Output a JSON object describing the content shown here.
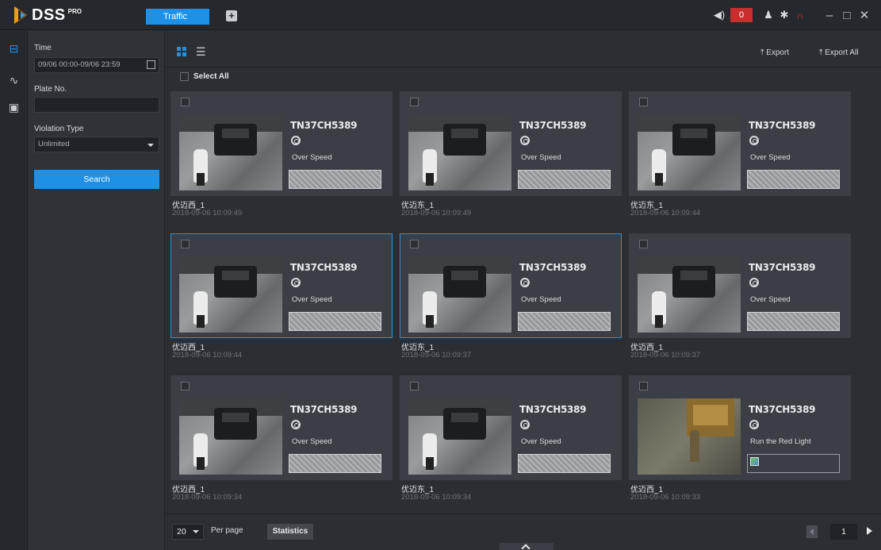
{
  "app": {
    "logo_text": "DSS",
    "logo_sup": "PRO",
    "active_tab": "Traffic",
    "alarm_count": "0"
  },
  "filter": {
    "time_label": "Time",
    "time_value": "09/06 00:00-09/06 23:59",
    "plate_label": "Plate No.",
    "plate_value": "",
    "violation_label": "Violation Type",
    "violation_value": "Unlimited",
    "search_label": "Search"
  },
  "toolbar": {
    "export_label": "Export",
    "export_all_label": "Export All",
    "select_all_label": "Select All"
  },
  "records": [
    {
      "plate": "TN37CH5389",
      "violation": "Over Speed",
      "camera": "优迈西_1",
      "time": "2018-09-06 10:09:49",
      "selected": false
    },
    {
      "plate": "TN37CH5389",
      "violation": "Over Speed",
      "camera": "优迈东_1",
      "time": "2018-09-06 10:09:49",
      "selected": false
    },
    {
      "plate": "TN37CH5389",
      "violation": "Over Speed",
      "camera": "优迈东_1",
      "time": "2018-09-06 10:09:44",
      "selected": false
    },
    {
      "plate": "TN37CH5389",
      "violation": "Over Speed",
      "camera": "优迈西_1",
      "time": "2018-09-06 10:09:44",
      "selected": true
    },
    {
      "plate": "TN37CH5389",
      "violation": "Over Speed",
      "camera": "优迈东_1",
      "time": "2018-09-06 10:09:37",
      "selected": true
    },
    {
      "plate": "TN37CH5389",
      "violation": "Over Speed",
      "camera": "优迈西_1",
      "time": "2018-09-06 10:09:37",
      "selected": false
    },
    {
      "plate": "TN37CH5389",
      "violation": "Over Speed",
      "camera": "优迈西_1",
      "time": "2018-09-06 10:09:34",
      "selected": false
    },
    {
      "plate": "TN37CH5389",
      "violation": "Over Speed",
      "camera": "优迈东_1",
      "time": "2018-09-06 10:09:34",
      "selected": false
    },
    {
      "plate": "TN37CH5389",
      "violation": "Run the Red Light",
      "camera": "优迈西_1",
      "time": "2018-09-06 10:09:33",
      "selected": false
    }
  ],
  "footer": {
    "per_page_value": "20",
    "per_page_label": "Per page",
    "statistics_label": "Statistics",
    "current_page": "1"
  },
  "colors": {
    "accent": "#1e90e6",
    "alarm": "#c72e2e",
    "background": "#2b2e33",
    "card": "#3b3e44"
  }
}
